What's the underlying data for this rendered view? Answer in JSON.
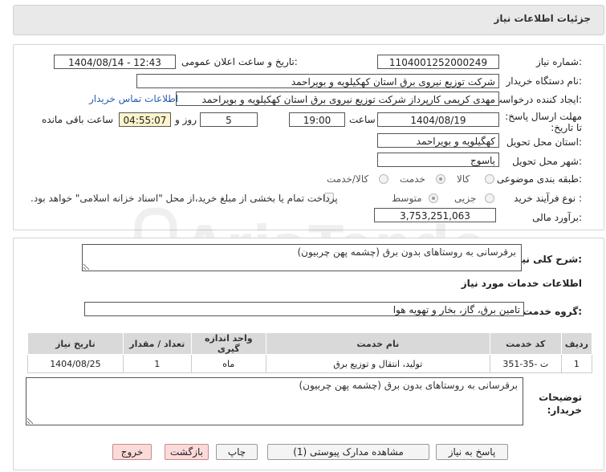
{
  "header": {
    "title": "جزئیات اطلاعات نیاز"
  },
  "form": {
    "need_number_label": "شماره نیاز:",
    "need_number": "1104001252000249",
    "announce_label": "تاریخ و ساعت اعلان عمومی:",
    "announce_value": "1404/08/14 - 12:43",
    "buyer_org_label": "نام دستگاه خریدار:",
    "buyer_org": "شرکت توزیع نیروی برق استان کهکیلویه و بویراحمد",
    "creator_label": "ایجاد کننده درخواست:",
    "creator": "مهدی کریمی کارپرداز شرکت توزیع نیروی برق استان کهکیلویه و بویراحمد",
    "contact_link": "اطلاعات تماس خریدار",
    "deadline_label": "مهلت ارسال پاسخ: تا تاریخ:",
    "deadline_date": "1404/08/19",
    "time_label": "ساعت",
    "deadline_time": "19:00",
    "days_value": "5",
    "days_label": "روز و",
    "remaining_time": "04:55:07",
    "remaining_label": "ساعت باقی مانده",
    "province_label": "استان محل تحویل:",
    "province": "کهگیلویه و بویراحمد",
    "city_label": "شهر محل تحویل:",
    "city": "یاسوج",
    "category_label": "طبقه بندی موضوعی:",
    "category_options": [
      "کالا",
      "خدمت",
      "کالا/خدمت"
    ],
    "category_selected": "خدمت",
    "process_label": "نوع فرآیند خرید :",
    "process_options": [
      "جزیی",
      "متوسط"
    ],
    "process_selected": "متوسط",
    "payment_note": "پرداخت تمام یا بخشی از مبلغ خرید،از محل \"اسناد خزانه اسلامی\" خواهد بود.",
    "estimate_label": "برآورد مالی:",
    "estimate": "3,753,251,063"
  },
  "details": {
    "general_desc_label": "شرح کلی نیاز:",
    "general_desc": "برقرسانی به روستاهای بدون برق (چشمه پهن چربیون)",
    "services_info_title": "اطلاعات خدمات مورد نیاز",
    "service_group_label": "گروه خدمت:",
    "service_group": "تامین برق، گاز، بخار و تهویه هوا",
    "table": {
      "headers": [
        "ردیف",
        "کد خدمت",
        "نام خدمت",
        "واحد اندازه گیری",
        "تعداد / مقدار",
        "تاریخ نیاز"
      ],
      "rows": [
        [
          "1",
          "ت -35-351",
          "تولید، انتقال و توزیع برق",
          "ماه",
          "1",
          "1404/08/25"
        ]
      ]
    },
    "buyer_notes_label": "توضیحات خریدار:",
    "buyer_notes": "برقرسانی به روستاهای بدون برق (چشمه پهن چربیون)"
  },
  "buttons": {
    "reply": "پاسخ به نیاز",
    "attachments": "مشاهده مدارک پیوستی (1)",
    "print": "چاپ",
    "back": "بازگشت",
    "exit": "خروج"
  },
  "colors": {
    "link": "#2a5db0",
    "danger_button": "#fbdada",
    "table_header": "#d9d9d9"
  }
}
